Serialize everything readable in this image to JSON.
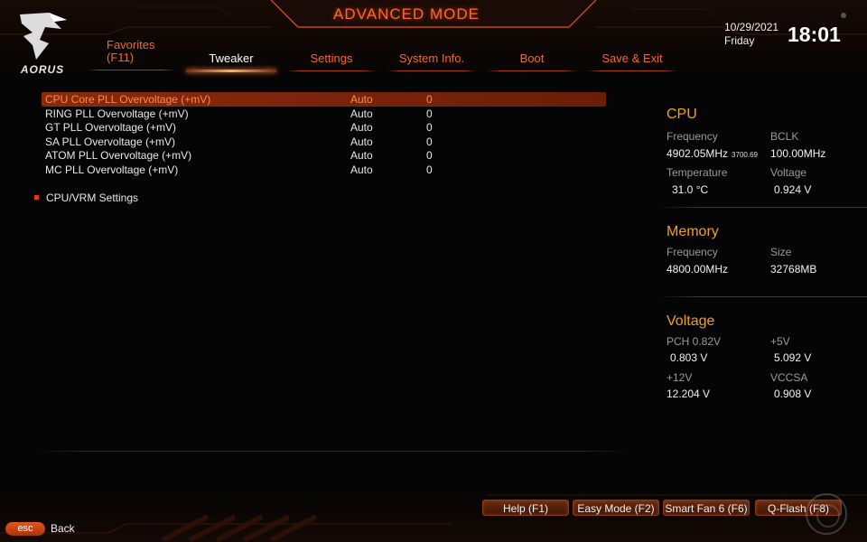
{
  "header": {
    "mode_title": "ADVANCED MODE",
    "brand": "AORUS",
    "date": "10/29/2021",
    "day": "Friday",
    "time": "18:01"
  },
  "tabs": [
    {
      "label_line1": "Favorites",
      "label_line2": "(F11)",
      "active": false
    },
    {
      "label": "Tweaker",
      "active": true
    },
    {
      "label": "Settings",
      "active": false
    },
    {
      "label": "System Info.",
      "active": false
    },
    {
      "label": "Boot",
      "active": false
    },
    {
      "label": "Save & Exit",
      "active": false
    }
  ],
  "settings": [
    {
      "label": "CPU Core PLL Overvoltage (+mV)",
      "mode": "Auto",
      "value": "0",
      "selected": true
    },
    {
      "label": "RING PLL Overvoltage (+mV)",
      "mode": "Auto",
      "value": "0"
    },
    {
      "label": "GT PLL Overvoltage (+mV)",
      "mode": "Auto",
      "value": "0"
    },
    {
      "label": "SA PLL Overvoltage (+mV)",
      "mode": "Auto",
      "value": "0"
    },
    {
      "label": "ATOM PLL Overvoltage (+mV)",
      "mode": "Auto",
      "value": "0"
    },
    {
      "label": "MC PLL Overvoltage (+mV)",
      "mode": "Auto",
      "value": "0"
    }
  ],
  "submenu": {
    "label": "CPU/VRM Settings"
  },
  "info": {
    "cpu": {
      "title": "CPU",
      "frequency_label": "Frequency",
      "frequency_value": "4902.05MHz",
      "frequency_sub": "3700.69",
      "bclk_label": "BCLK",
      "bclk_value": "100.00MHz",
      "temperature_label": "Temperature",
      "temperature_value": "31.0 °C",
      "voltage_label": "Voltage",
      "voltage_value": "0.924 V"
    },
    "memory": {
      "title": "Memory",
      "frequency_label": "Frequency",
      "frequency_value": "4800.00MHz",
      "size_label": "Size",
      "size_value": "32768MB"
    },
    "voltage": {
      "title": "Voltage",
      "pch_label": "PCH 0.82V",
      "pch_value": "0.803 V",
      "v5_label": "+5V",
      "v5_value": "5.092 V",
      "v12_label": "+12V",
      "v12_value": "12.204 V",
      "vccsa_label": "VCCSA",
      "vccsa_value": "0.908 V"
    }
  },
  "footer": {
    "help": "Help (F1)",
    "easy_mode": "Easy Mode (F2)",
    "smart_fan": "Smart Fan 6 (F6)",
    "qflash": "Q-Flash (F8)",
    "esc": "esc",
    "back": "Back"
  },
  "colors": {
    "accent": "#ee6b2f",
    "section_title": "#f0a020",
    "selection": "#8a2a0c"
  },
  "icons": {
    "logo": "aorus-eagle-icon",
    "bullet": "square-bullet-icon"
  }
}
